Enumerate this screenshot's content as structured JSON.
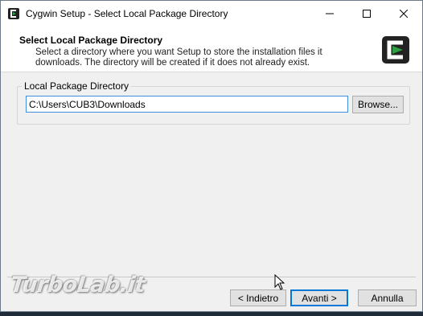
{
  "window": {
    "title": "Cygwin Setup - Select Local Package Directory",
    "minimize_glyph": "—",
    "maximize_glyph": "☐",
    "close_glyph": "✕"
  },
  "header": {
    "title": "Select Local Package Directory",
    "description": "Select a directory where you want Setup to store the installation files it downloads.  The directory will be created if it does not already exist."
  },
  "group": {
    "label": "Local Package Directory",
    "path_value": "C:\\Users\\CUB3\\Downloads",
    "browse_label": "Browse..."
  },
  "footer": {
    "back_label": "< Indietro",
    "next_label": "Avanti >",
    "cancel_label": "Annulla"
  },
  "watermark": {
    "text": "TurboLab.it"
  },
  "colors": {
    "accent": "#0078d7",
    "cygwin_green": "#2ea043",
    "cygwin_dark": "#222222"
  },
  "icons": [
    "cygwin-app-icon",
    "cygwin-logo-icon",
    "minimize-icon",
    "maximize-icon",
    "close-icon",
    "mouse-cursor-icon"
  ]
}
